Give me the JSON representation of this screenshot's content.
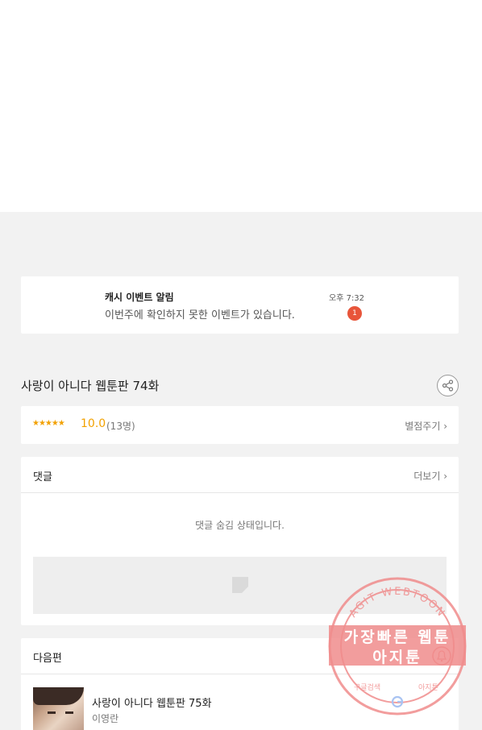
{
  "notification": {
    "title": "캐시 이벤트 알림",
    "body": "이번주에 확인하지 못한 이벤트가 있습니다.",
    "time": "오후 7:32",
    "badge": "1"
  },
  "episode": {
    "title": "사랑이 아니다 웹툰판 74화",
    "share_icon": "share-icon"
  },
  "rating": {
    "stars": "★★★★★",
    "score": "10.0",
    "count": "(13명)",
    "rate_link": "별점주기 ›"
  },
  "comments": {
    "title": "댓글",
    "more": "더보기 ›",
    "hidden_message": "댓글 숨김 상태입니다."
  },
  "next_episode": {
    "section_title": "다음편",
    "title": "사랑이 아니다 웹툰판 75화",
    "author": "이영란"
  },
  "watermark": {
    "line1": "가장빠른 웹툰",
    "line2": "아지툰",
    "ring_top": "AGIT WEBTOON",
    "ring_left": "구글검색",
    "ring_right": "아지툰",
    "color": "#f08c8c"
  },
  "colors": {
    "accent_star": "#f2a100",
    "badge": "#e8553a"
  }
}
